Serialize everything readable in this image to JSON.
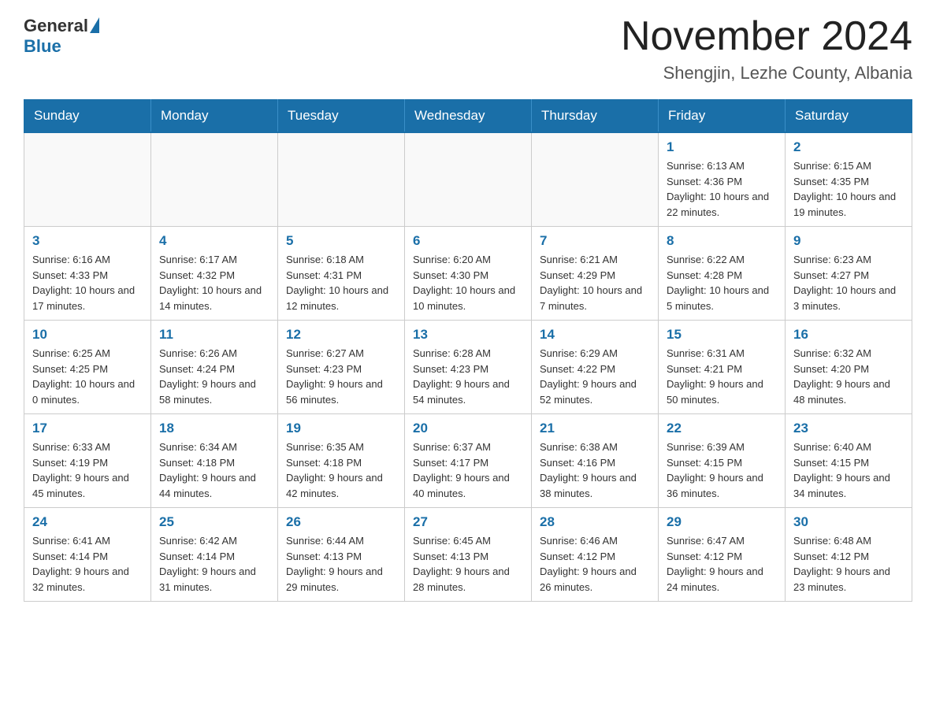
{
  "header": {
    "logo_general": "General",
    "logo_blue": "Blue",
    "month_title": "November 2024",
    "location": "Shengjin, Lezhe County, Albania"
  },
  "days_of_week": [
    "Sunday",
    "Monday",
    "Tuesday",
    "Wednesday",
    "Thursday",
    "Friday",
    "Saturday"
  ],
  "weeks": [
    [
      {
        "day": "",
        "info": ""
      },
      {
        "day": "",
        "info": ""
      },
      {
        "day": "",
        "info": ""
      },
      {
        "day": "",
        "info": ""
      },
      {
        "day": "",
        "info": ""
      },
      {
        "day": "1",
        "info": "Sunrise: 6:13 AM\nSunset: 4:36 PM\nDaylight: 10 hours and 22 minutes."
      },
      {
        "day": "2",
        "info": "Sunrise: 6:15 AM\nSunset: 4:35 PM\nDaylight: 10 hours and 19 minutes."
      }
    ],
    [
      {
        "day": "3",
        "info": "Sunrise: 6:16 AM\nSunset: 4:33 PM\nDaylight: 10 hours and 17 minutes."
      },
      {
        "day": "4",
        "info": "Sunrise: 6:17 AM\nSunset: 4:32 PM\nDaylight: 10 hours and 14 minutes."
      },
      {
        "day": "5",
        "info": "Sunrise: 6:18 AM\nSunset: 4:31 PM\nDaylight: 10 hours and 12 minutes."
      },
      {
        "day": "6",
        "info": "Sunrise: 6:20 AM\nSunset: 4:30 PM\nDaylight: 10 hours and 10 minutes."
      },
      {
        "day": "7",
        "info": "Sunrise: 6:21 AM\nSunset: 4:29 PM\nDaylight: 10 hours and 7 minutes."
      },
      {
        "day": "8",
        "info": "Sunrise: 6:22 AM\nSunset: 4:28 PM\nDaylight: 10 hours and 5 minutes."
      },
      {
        "day": "9",
        "info": "Sunrise: 6:23 AM\nSunset: 4:27 PM\nDaylight: 10 hours and 3 minutes."
      }
    ],
    [
      {
        "day": "10",
        "info": "Sunrise: 6:25 AM\nSunset: 4:25 PM\nDaylight: 10 hours and 0 minutes."
      },
      {
        "day": "11",
        "info": "Sunrise: 6:26 AM\nSunset: 4:24 PM\nDaylight: 9 hours and 58 minutes."
      },
      {
        "day": "12",
        "info": "Sunrise: 6:27 AM\nSunset: 4:23 PM\nDaylight: 9 hours and 56 minutes."
      },
      {
        "day": "13",
        "info": "Sunrise: 6:28 AM\nSunset: 4:23 PM\nDaylight: 9 hours and 54 minutes."
      },
      {
        "day": "14",
        "info": "Sunrise: 6:29 AM\nSunset: 4:22 PM\nDaylight: 9 hours and 52 minutes."
      },
      {
        "day": "15",
        "info": "Sunrise: 6:31 AM\nSunset: 4:21 PM\nDaylight: 9 hours and 50 minutes."
      },
      {
        "day": "16",
        "info": "Sunrise: 6:32 AM\nSunset: 4:20 PM\nDaylight: 9 hours and 48 minutes."
      }
    ],
    [
      {
        "day": "17",
        "info": "Sunrise: 6:33 AM\nSunset: 4:19 PM\nDaylight: 9 hours and 45 minutes."
      },
      {
        "day": "18",
        "info": "Sunrise: 6:34 AM\nSunset: 4:18 PM\nDaylight: 9 hours and 44 minutes."
      },
      {
        "day": "19",
        "info": "Sunrise: 6:35 AM\nSunset: 4:18 PM\nDaylight: 9 hours and 42 minutes."
      },
      {
        "day": "20",
        "info": "Sunrise: 6:37 AM\nSunset: 4:17 PM\nDaylight: 9 hours and 40 minutes."
      },
      {
        "day": "21",
        "info": "Sunrise: 6:38 AM\nSunset: 4:16 PM\nDaylight: 9 hours and 38 minutes."
      },
      {
        "day": "22",
        "info": "Sunrise: 6:39 AM\nSunset: 4:15 PM\nDaylight: 9 hours and 36 minutes."
      },
      {
        "day": "23",
        "info": "Sunrise: 6:40 AM\nSunset: 4:15 PM\nDaylight: 9 hours and 34 minutes."
      }
    ],
    [
      {
        "day": "24",
        "info": "Sunrise: 6:41 AM\nSunset: 4:14 PM\nDaylight: 9 hours and 32 minutes."
      },
      {
        "day": "25",
        "info": "Sunrise: 6:42 AM\nSunset: 4:14 PM\nDaylight: 9 hours and 31 minutes."
      },
      {
        "day": "26",
        "info": "Sunrise: 6:44 AM\nSunset: 4:13 PM\nDaylight: 9 hours and 29 minutes."
      },
      {
        "day": "27",
        "info": "Sunrise: 6:45 AM\nSunset: 4:13 PM\nDaylight: 9 hours and 28 minutes."
      },
      {
        "day": "28",
        "info": "Sunrise: 6:46 AM\nSunset: 4:12 PM\nDaylight: 9 hours and 26 minutes."
      },
      {
        "day": "29",
        "info": "Sunrise: 6:47 AM\nSunset: 4:12 PM\nDaylight: 9 hours and 24 minutes."
      },
      {
        "day": "30",
        "info": "Sunrise: 6:48 AM\nSunset: 4:12 PM\nDaylight: 9 hours and 23 minutes."
      }
    ]
  ]
}
